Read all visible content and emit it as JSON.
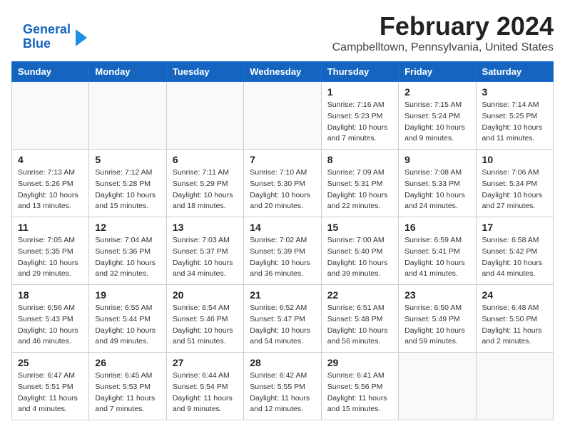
{
  "logo": {
    "line1": "General",
    "line2": "Blue"
  },
  "title": "February 2024",
  "location": "Campbelltown, Pennsylvania, United States",
  "days_of_week": [
    "Sunday",
    "Monday",
    "Tuesday",
    "Wednesday",
    "Thursday",
    "Friday",
    "Saturday"
  ],
  "weeks": [
    [
      {
        "day": "",
        "info": ""
      },
      {
        "day": "",
        "info": ""
      },
      {
        "day": "",
        "info": ""
      },
      {
        "day": "",
        "info": ""
      },
      {
        "day": "1",
        "info": "Sunrise: 7:16 AM\nSunset: 5:23 PM\nDaylight: 10 hours\nand 7 minutes."
      },
      {
        "day": "2",
        "info": "Sunrise: 7:15 AM\nSunset: 5:24 PM\nDaylight: 10 hours\nand 9 minutes."
      },
      {
        "day": "3",
        "info": "Sunrise: 7:14 AM\nSunset: 5:25 PM\nDaylight: 10 hours\nand 11 minutes."
      }
    ],
    [
      {
        "day": "4",
        "info": "Sunrise: 7:13 AM\nSunset: 5:26 PM\nDaylight: 10 hours\nand 13 minutes."
      },
      {
        "day": "5",
        "info": "Sunrise: 7:12 AM\nSunset: 5:28 PM\nDaylight: 10 hours\nand 15 minutes."
      },
      {
        "day": "6",
        "info": "Sunrise: 7:11 AM\nSunset: 5:29 PM\nDaylight: 10 hours\nand 18 minutes."
      },
      {
        "day": "7",
        "info": "Sunrise: 7:10 AM\nSunset: 5:30 PM\nDaylight: 10 hours\nand 20 minutes."
      },
      {
        "day": "8",
        "info": "Sunrise: 7:09 AM\nSunset: 5:31 PM\nDaylight: 10 hours\nand 22 minutes."
      },
      {
        "day": "9",
        "info": "Sunrise: 7:08 AM\nSunset: 5:33 PM\nDaylight: 10 hours\nand 24 minutes."
      },
      {
        "day": "10",
        "info": "Sunrise: 7:06 AM\nSunset: 5:34 PM\nDaylight: 10 hours\nand 27 minutes."
      }
    ],
    [
      {
        "day": "11",
        "info": "Sunrise: 7:05 AM\nSunset: 5:35 PM\nDaylight: 10 hours\nand 29 minutes."
      },
      {
        "day": "12",
        "info": "Sunrise: 7:04 AM\nSunset: 5:36 PM\nDaylight: 10 hours\nand 32 minutes."
      },
      {
        "day": "13",
        "info": "Sunrise: 7:03 AM\nSunset: 5:37 PM\nDaylight: 10 hours\nand 34 minutes."
      },
      {
        "day": "14",
        "info": "Sunrise: 7:02 AM\nSunset: 5:39 PM\nDaylight: 10 hours\nand 36 minutes."
      },
      {
        "day": "15",
        "info": "Sunrise: 7:00 AM\nSunset: 5:40 PM\nDaylight: 10 hours\nand 39 minutes."
      },
      {
        "day": "16",
        "info": "Sunrise: 6:59 AM\nSunset: 5:41 PM\nDaylight: 10 hours\nand 41 minutes."
      },
      {
        "day": "17",
        "info": "Sunrise: 6:58 AM\nSunset: 5:42 PM\nDaylight: 10 hours\nand 44 minutes."
      }
    ],
    [
      {
        "day": "18",
        "info": "Sunrise: 6:56 AM\nSunset: 5:43 PM\nDaylight: 10 hours\nand 46 minutes."
      },
      {
        "day": "19",
        "info": "Sunrise: 6:55 AM\nSunset: 5:44 PM\nDaylight: 10 hours\nand 49 minutes."
      },
      {
        "day": "20",
        "info": "Sunrise: 6:54 AM\nSunset: 5:46 PM\nDaylight: 10 hours\nand 51 minutes."
      },
      {
        "day": "21",
        "info": "Sunrise: 6:52 AM\nSunset: 5:47 PM\nDaylight: 10 hours\nand 54 minutes."
      },
      {
        "day": "22",
        "info": "Sunrise: 6:51 AM\nSunset: 5:48 PM\nDaylight: 10 hours\nand 56 minutes."
      },
      {
        "day": "23",
        "info": "Sunrise: 6:50 AM\nSunset: 5:49 PM\nDaylight: 10 hours\nand 59 minutes."
      },
      {
        "day": "24",
        "info": "Sunrise: 6:48 AM\nSunset: 5:50 PM\nDaylight: 11 hours\nand 2 minutes."
      }
    ],
    [
      {
        "day": "25",
        "info": "Sunrise: 6:47 AM\nSunset: 5:51 PM\nDaylight: 11 hours\nand 4 minutes."
      },
      {
        "day": "26",
        "info": "Sunrise: 6:45 AM\nSunset: 5:53 PM\nDaylight: 11 hours\nand 7 minutes."
      },
      {
        "day": "27",
        "info": "Sunrise: 6:44 AM\nSunset: 5:54 PM\nDaylight: 11 hours\nand 9 minutes."
      },
      {
        "day": "28",
        "info": "Sunrise: 6:42 AM\nSunset: 5:55 PM\nDaylight: 11 hours\nand 12 minutes."
      },
      {
        "day": "29",
        "info": "Sunrise: 6:41 AM\nSunset: 5:56 PM\nDaylight: 11 hours\nand 15 minutes."
      },
      {
        "day": "",
        "info": ""
      },
      {
        "day": "",
        "info": ""
      }
    ]
  ]
}
